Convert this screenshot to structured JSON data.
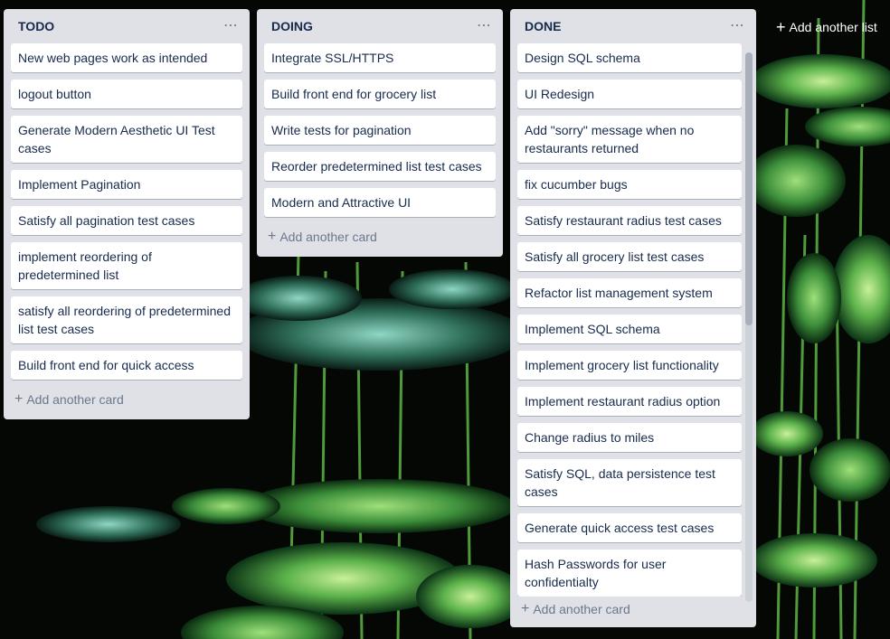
{
  "board": {
    "lists": [
      {
        "title": "TODO",
        "menu": "⋯",
        "cards": [
          "New web pages work as intended",
          "logout button",
          "Generate Modern Aesthetic UI Test cases",
          "Implement Pagination",
          "Satisfy all pagination test cases",
          "implement reordering of predetermined list",
          "satisfy all reordering of predetermined list test cases",
          "Build front end for quick access"
        ],
        "add_card": "Add another card"
      },
      {
        "title": "DOING",
        "menu": "⋯",
        "cards": [
          "Integrate SSL/HTTPS",
          "Build front end for grocery list",
          "Write tests for pagination",
          "Reorder predetermined list test cases",
          "Modern and Attractive UI"
        ],
        "add_card": "Add another card"
      },
      {
        "title": "DONE",
        "menu": "⋯",
        "cards": [
          "Design SQL schema",
          "UI Redesign",
          "Add \"sorry\" message when no restaurants returned",
          "fix cucumber bugs",
          "Satisfy restaurant radius test cases",
          "Satisfy all grocery list test cases",
          "Refactor list management system",
          "Implement SQL schema",
          "Implement grocery list functionality",
          "Implement restaurant radius option",
          "Change radius to miles",
          "Satisfy SQL, data persistence test cases",
          "Generate quick access test cases",
          "Hash Passwords for user confidentialty"
        ],
        "add_card": "Add another card"
      }
    ],
    "add_list": "Add another list",
    "plus": "+",
    "background": "lotus-pond-photo"
  }
}
